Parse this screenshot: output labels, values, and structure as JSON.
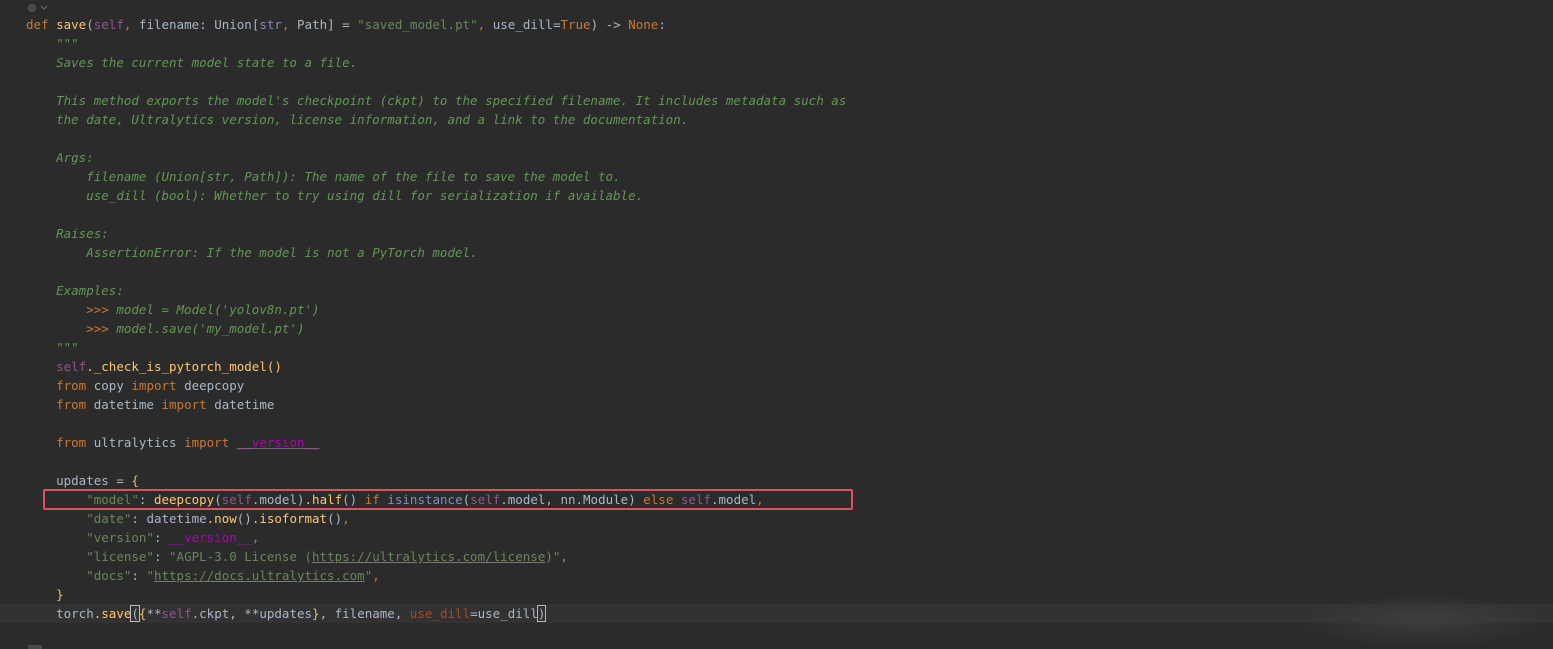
{
  "editor": {
    "top_icon": "fold-icon",
    "lines": {
      "l1": {
        "def": "def",
        "name": "save",
        "self": "self",
        "p1": "filename",
        "colon": ": ",
        "union": "Union",
        "str": "str",
        "path": "Path",
        "eq": " = ",
        "default_str": "\"saved_model.pt\"",
        "p2": "use_dill",
        "eq2": "=",
        "true": "True",
        "arrow": " -> ",
        "none": "None",
        "end": ":"
      },
      "doc_open": "\"\"\"",
      "doc1": "Saves the current model state to a file.",
      "doc2": "This method exports the model's checkpoint (ckpt) to the specified filename. It includes metadata such as",
      "doc3": "the date, Ultralytics version, license information, and a link to the documentation.",
      "args": "Args:",
      "arg1": "filename (Union[str, Path]): The name of the file to save the model to.",
      "arg2": "use_dill (bool): Whether to try using dill for serialization if available.",
      "raises": "Raises:",
      "raise1": "AssertionError: If the model is not a PyTorch model.",
      "examples": "Examples:",
      "ex_prompt": ">>>",
      "ex1": "model = Model('yolov8n.pt')",
      "ex2": "model.save('my_model.pt')",
      "doc_close": "\"\"\"",
      "check_self": "self",
      "check_call": "._check_is_pytorch_model()",
      "from": "from",
      "import": "import",
      "mod_copy": "copy",
      "deepcopy": "deepcopy",
      "mod_datetime": "datetime",
      "datetime": "datetime",
      "mod_ultralytics": "ultralytics",
      "version_dunder": "__version__",
      "updates": "updates = ",
      "brace_open": "{",
      "brace_close": "}",
      "key_model": "\"model\"",
      "model_val_fn": "deepcopy",
      "model_val_self": "self",
      "model_val_attr": ".model",
      "half": ".half",
      "if": "if",
      "isinstance": "isinstance",
      "nn_module": ".model, nn.Module",
      "else": "else",
      "key_date": "\"date\"",
      "date_val_mod": "datetime",
      "now": ".now",
      "isoformat": ".isoformat",
      "key_version": "\"version\"",
      "key_license": "\"license\"",
      "license_prefix": "\"AGPL-3.0 License (",
      "license_url": "https://ultralytics.com/license",
      "license_suffix": ")\"",
      "key_docs": "\"docs\"",
      "docs_url": "https://docs.ultralytics.com",
      "torch": "torch",
      "torch_save": ".save",
      "ckpt_pre": "**",
      "ckpt_self": "self",
      "ckpt_rest": ".ckpt, **updates",
      "filename": ", filename, ",
      "use_dill_kw": "use_dill",
      "use_dill_val": "=use_dill"
    }
  }
}
